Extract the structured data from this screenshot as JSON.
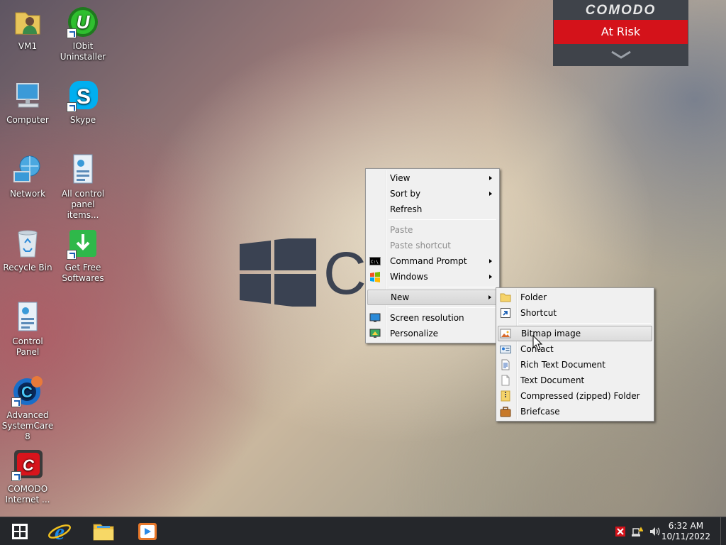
{
  "desktop": {
    "icons": [
      {
        "label": "VM1",
        "icon": "user-folder-icon"
      },
      {
        "label": "IObit Uninstaller",
        "icon": "iobit-uninstaller-icon"
      },
      {
        "label": "Computer",
        "icon": "computer-icon"
      },
      {
        "label": "Skype",
        "icon": "skype-icon"
      },
      {
        "label": "Network",
        "icon": "network-icon"
      },
      {
        "label": "All control panel items...",
        "icon": "control-panel-items-icon"
      },
      {
        "label": "Recycle Bin",
        "icon": "recycle-bin-icon"
      },
      {
        "label": "Get Free Softwares",
        "icon": "get-free-softwares-icon"
      },
      {
        "label": "Control Panel",
        "icon": "control-panel-icon"
      },
      {
        "label": "Advanced SystemCare 8",
        "icon": "advanced-systemcare-icon"
      },
      {
        "label": "COMODO Internet ...",
        "icon": "comodo-internet-security-icon"
      }
    ],
    "watermark_letter": "C"
  },
  "comodo_widget": {
    "brand": "COMODO",
    "status": "At Risk",
    "colors": {
      "status_bg": "#d4121a",
      "panel_bg": "#3f434a"
    }
  },
  "context_menu": {
    "items": [
      {
        "label": "View"
      },
      {
        "label": "Sort by"
      },
      {
        "label": "Refresh"
      },
      {
        "label": "Paste"
      },
      {
        "label": "Paste shortcut"
      },
      {
        "label": "Command Prompt"
      },
      {
        "label": "Windows"
      },
      {
        "label": "New"
      },
      {
        "label": "Screen resolution"
      },
      {
        "label": "Personalize"
      }
    ]
  },
  "new_submenu": {
    "items": [
      {
        "label": "Folder"
      },
      {
        "label": "Shortcut"
      },
      {
        "label": "Bitmap image"
      },
      {
        "label": "Contact"
      },
      {
        "label": "Rich Text Document"
      },
      {
        "label": "Text Document"
      },
      {
        "label": "Compressed (zipped) Folder"
      },
      {
        "label": "Briefcase"
      }
    ]
  },
  "taskbar": {
    "pinned": [
      "start-icon",
      "internet-explorer-icon",
      "file-explorer-icon",
      "media-player-icon"
    ],
    "clock": {
      "time": "6:32 AM",
      "date": "10/11/2022"
    }
  }
}
